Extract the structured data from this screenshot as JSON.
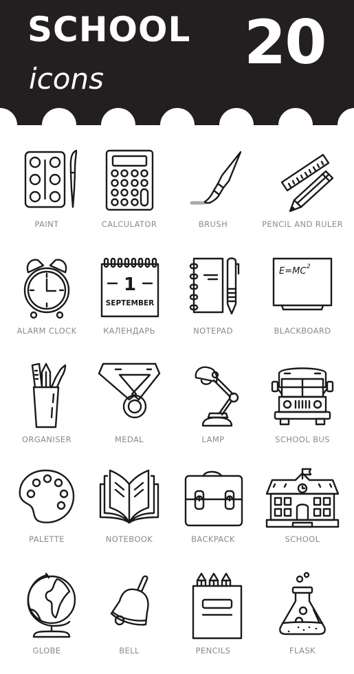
{
  "header": {
    "title": "SCHOOL",
    "subtitle": "icons",
    "count": "20",
    "background_color": "#231f20",
    "text_color": "#ffffff"
  },
  "icons": [
    {
      "label": "PAINT",
      "icon": "paint-icon"
    },
    {
      "label": "CALCULATOR",
      "icon": "calculator-icon"
    },
    {
      "label": "BRUSH",
      "icon": "brush-icon"
    },
    {
      "label": "PENCIL AND RULER",
      "icon": "pencil-ruler-icon"
    },
    {
      "label": "ALARM CLOCK",
      "icon": "alarm-clock-icon"
    },
    {
      "label": "КАЛЕНДАРЬ",
      "icon": "calendar-icon"
    },
    {
      "label": "NOTEPAD",
      "icon": "notepad-icon"
    },
    {
      "label": "BLACKBOARD",
      "icon": "blackboard-icon"
    },
    {
      "label": "ORGANISER",
      "icon": "organiser-icon"
    },
    {
      "label": "MEDAL",
      "icon": "medal-icon"
    },
    {
      "label": "LAMP",
      "icon": "lamp-icon"
    },
    {
      "label": "SCHOOL BUS",
      "icon": "school-bus-icon"
    },
    {
      "label": "PALETTE",
      "icon": "palette-icon"
    },
    {
      "label": "NOTEBOOK",
      "icon": "notebook-icon"
    },
    {
      "label": "BACKPACK",
      "icon": "backpack-icon"
    },
    {
      "label": "SCHOOL",
      "icon": "school-building-icon"
    },
    {
      "label": "GLOBE",
      "icon": "globe-icon"
    },
    {
      "label": "BELL",
      "icon": "bell-icon"
    },
    {
      "label": "PENCILS",
      "icon": "pencils-icon"
    },
    {
      "label": "FLASK",
      "icon": "flask-icon"
    }
  ],
  "calendar": {
    "day": "1",
    "month": "SEPTEMBER"
  },
  "blackboard": {
    "formula": "E=MC",
    "exponent": "2"
  },
  "label_color": "#8a8a8a",
  "stroke_color": "#1a1a1a"
}
